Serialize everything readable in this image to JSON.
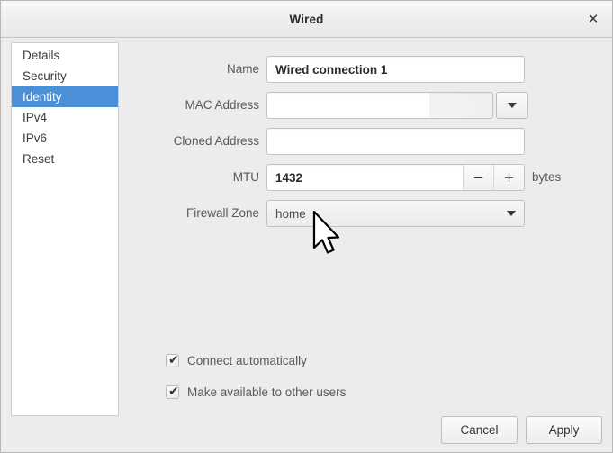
{
  "window": {
    "title": "Wired",
    "close_icon": "✕"
  },
  "sidebar": {
    "items": [
      {
        "label": "Details",
        "selected": false
      },
      {
        "label": "Security",
        "selected": false
      },
      {
        "label": "Identity",
        "selected": true
      },
      {
        "label": "IPv4",
        "selected": false
      },
      {
        "label": "IPv6",
        "selected": false
      },
      {
        "label": "Reset",
        "selected": false
      }
    ]
  },
  "form": {
    "name": {
      "label": "Name",
      "value": "Wired connection 1"
    },
    "mac_address": {
      "label": "MAC Address",
      "value": "",
      "dropdown_icon": "chevron-down-icon"
    },
    "cloned_address": {
      "label": "Cloned Address",
      "value": ""
    },
    "mtu": {
      "label": "MTU",
      "value": "1432",
      "decrement_label": "−",
      "increment_label": "+",
      "units": "bytes"
    },
    "firewall_zone": {
      "label": "Firewall Zone",
      "value": "home",
      "dropdown_icon": "chevron-down-icon"
    }
  },
  "options": [
    {
      "label": "Connect automatically",
      "checked": true,
      "check_glyph": "✔"
    },
    {
      "label": "Make available to other users",
      "checked": true,
      "check_glyph": "✔"
    }
  ],
  "actions": {
    "cancel_label": "Cancel",
    "apply_label": "Apply"
  },
  "colors": {
    "selection_blue": "#4a90d9",
    "window_bg": "#ececec",
    "field_bg": "#ffffff"
  }
}
